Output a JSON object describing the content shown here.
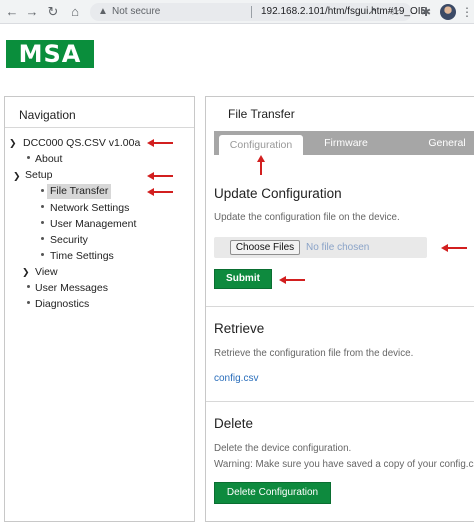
{
  "browser": {
    "security_label": "Not secure",
    "url": "192.168.2.101/htm/fsgui.htm#19_OID"
  },
  "logo": {
    "text": "MSA",
    "color": "#0a8e3c"
  },
  "navigation": {
    "title": "Navigation",
    "device": "DCC000 QS.CSV v1.00a",
    "about": "About",
    "setup": "Setup",
    "setup_items": [
      "File Transfer",
      "Network Settings",
      "User Management",
      "Security",
      "Time Settings"
    ],
    "view": "View",
    "user_messages": "User Messages",
    "diagnostics": "Diagnostics",
    "selected": "File Transfer"
  },
  "main": {
    "title": "File Transfer",
    "tabs": [
      "Configuration",
      "Firmware",
      "General"
    ],
    "active_tab": "Configuration",
    "update": {
      "title": "Update Configuration",
      "help": "Update the configuration file on the device.",
      "choose_label": "Choose Files",
      "no_file": "No file chosen",
      "submit_label": "Submit"
    },
    "retrieve": {
      "title": "Retrieve",
      "help": "Retrieve the configuration file from the device.",
      "link": "config.csv"
    },
    "delete": {
      "title": "Delete",
      "help": "Delete the device configuration.",
      "warning": "Warning: Make sure you have saved a copy of your config.csv",
      "button_label": "Delete Configuration"
    }
  },
  "colors": {
    "accent_green": "#0e8a3e",
    "annotation_arrow": "#d21f1f",
    "tab_gray": "#a6a6a6"
  }
}
